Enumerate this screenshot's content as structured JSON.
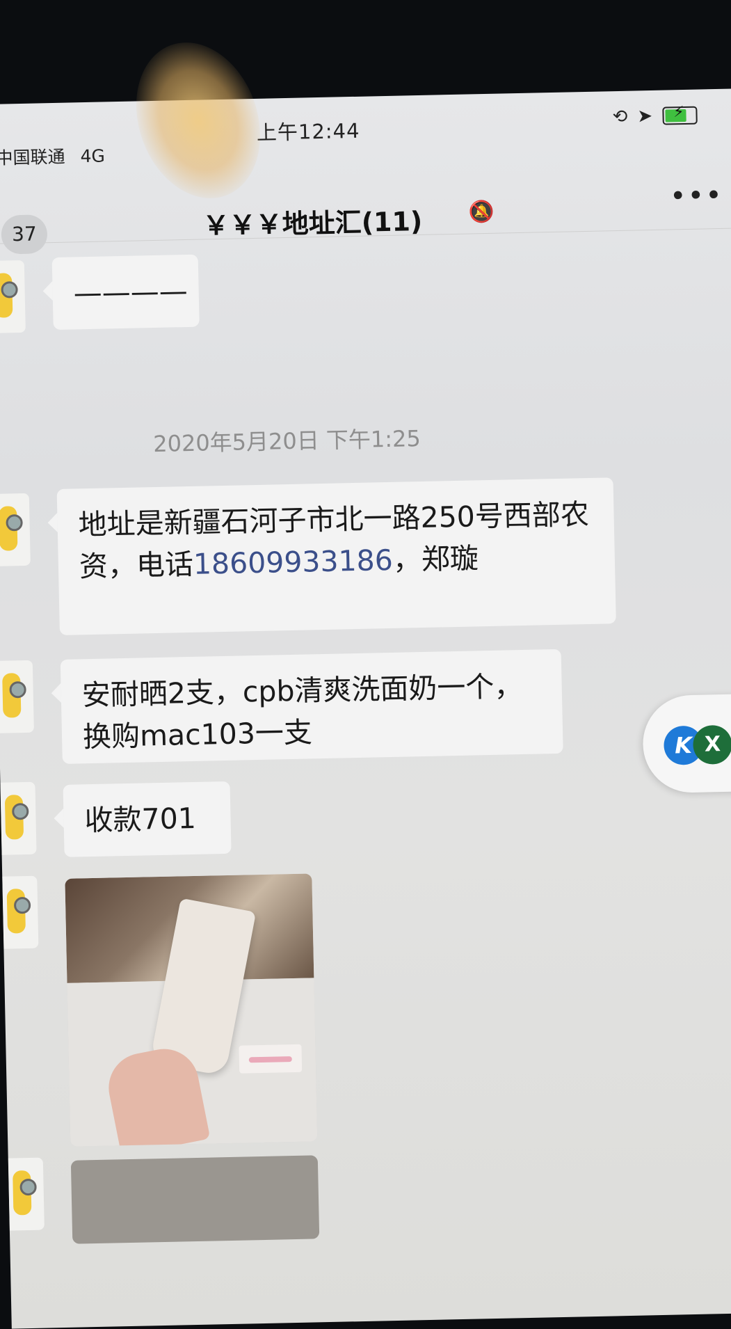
{
  "status_bar": {
    "carrier": "中国联通",
    "network": "4G",
    "time": "上午12:44"
  },
  "nav": {
    "back_count": "37",
    "title": "￥￥￥地址汇(11)",
    "more_label": "•••"
  },
  "messages": {
    "first_bubble": "————",
    "timestamp": "2020年5月20日 下午1:25",
    "address_prefix": "地址是新疆石河子市北一路250号西部农资，电话",
    "phone": "18609933186",
    "address_suffix": "，郑璇",
    "order_text": "安耐晒2支，cpb清爽洗面奶一个，换购mac103一支",
    "payment_text": "收款701"
  },
  "floating_widget": {
    "blue_label": "K",
    "green_label": "X"
  },
  "colors": {
    "link": "#3b4f8a",
    "bubble": "#f3f3f3",
    "widget_green": "#1e6e3a",
    "widget_blue": "#1f7ad8"
  }
}
